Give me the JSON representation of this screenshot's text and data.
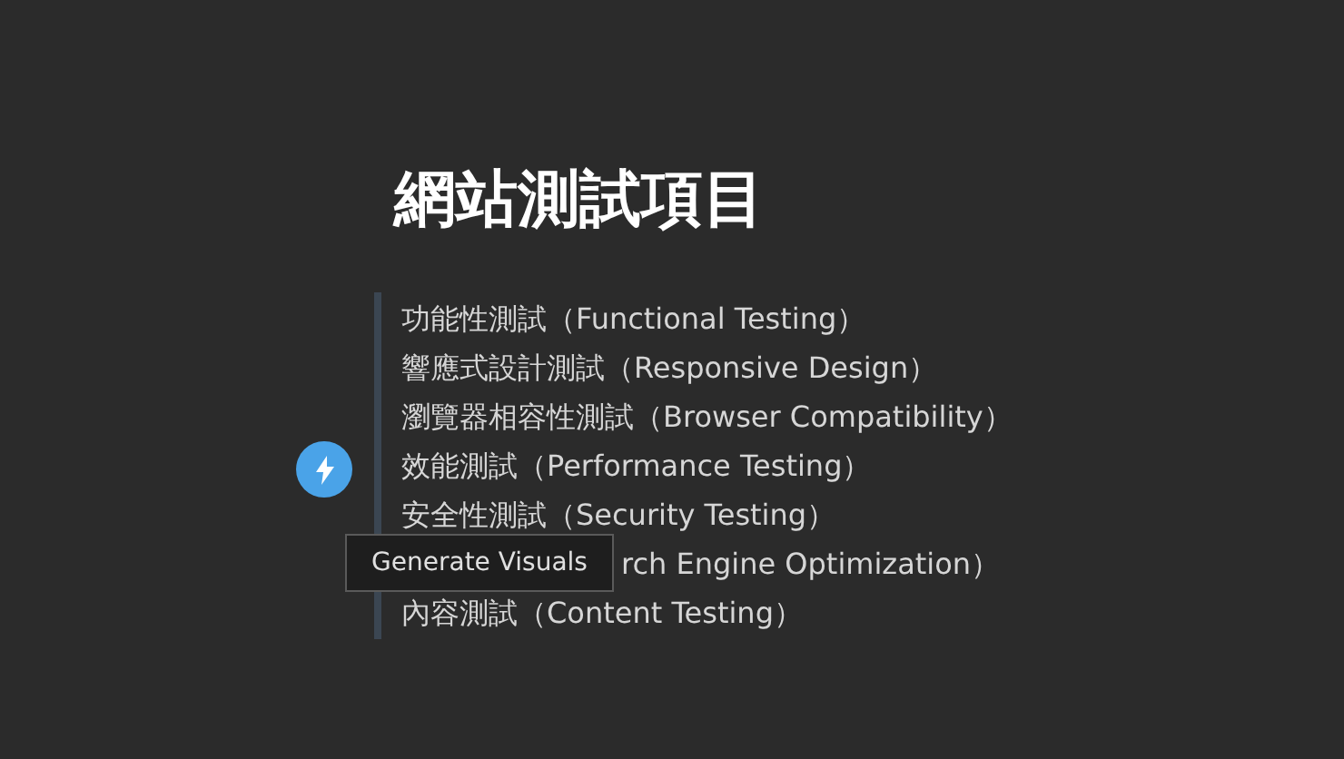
{
  "title": "網站測試項目",
  "items": [
    {
      "kind": "full",
      "text": "功能性測試（Functional Testing）"
    },
    {
      "kind": "full",
      "text": "響應式設計測試（Responsive Design）"
    },
    {
      "kind": "full",
      "text": "瀏覽器相容性測試（Browser Compatibility）"
    },
    {
      "kind": "full",
      "text": "效能測試（Performance Testing）"
    },
    {
      "kind": "full",
      "text": "安全性測試（Security Testing）"
    },
    {
      "kind": "covered",
      "text": "rch Engine Optimization）"
    },
    {
      "kind": "full",
      "text": "內容測試（Content Testing）"
    }
  ],
  "tooltip": "Generate Visuals"
}
